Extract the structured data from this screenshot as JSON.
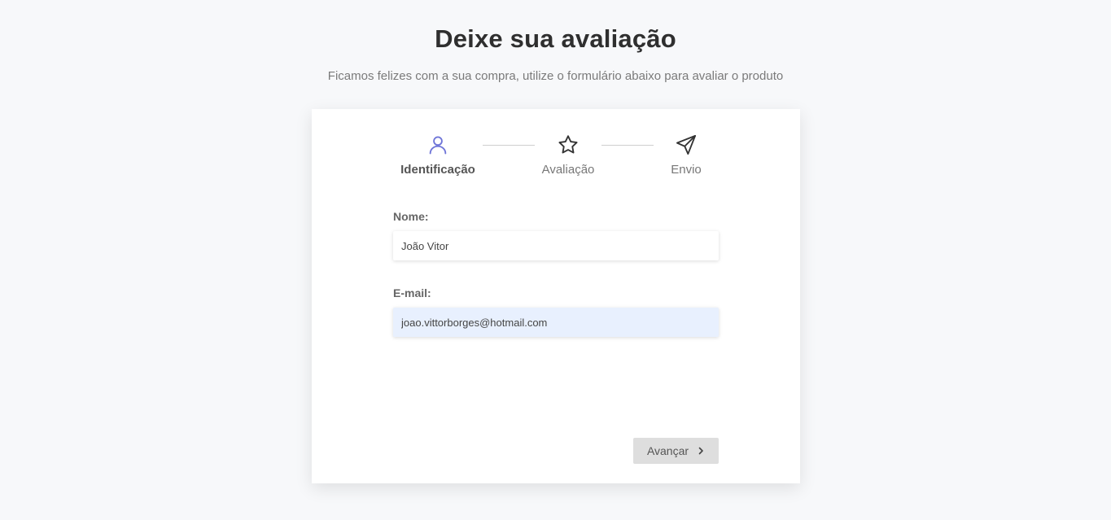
{
  "header": {
    "title": "Deixe sua avaliação",
    "subtitle": "Ficamos felizes com a sua compra, utilize o formulário abaixo para avaliar o produto"
  },
  "steps": [
    {
      "label": "Identificação",
      "icon": "user-icon",
      "active": true
    },
    {
      "label": "Avaliação",
      "icon": "star-icon",
      "active": false
    },
    {
      "label": "Envio",
      "icon": "send-icon",
      "active": false
    }
  ],
  "form": {
    "name_label": "Nome:",
    "name_value": "João Vitor",
    "email_label": "E-mail:",
    "email_value": "joao.vittorborges@hotmail.com"
  },
  "actions": {
    "next_label": "Avançar",
    "next_icon": "chevron-right-icon"
  },
  "colors": {
    "accent": "#6f75d8",
    "background": "#f7f8fa",
    "autofill": "#e8f0fe",
    "button_bg": "#dedede"
  }
}
